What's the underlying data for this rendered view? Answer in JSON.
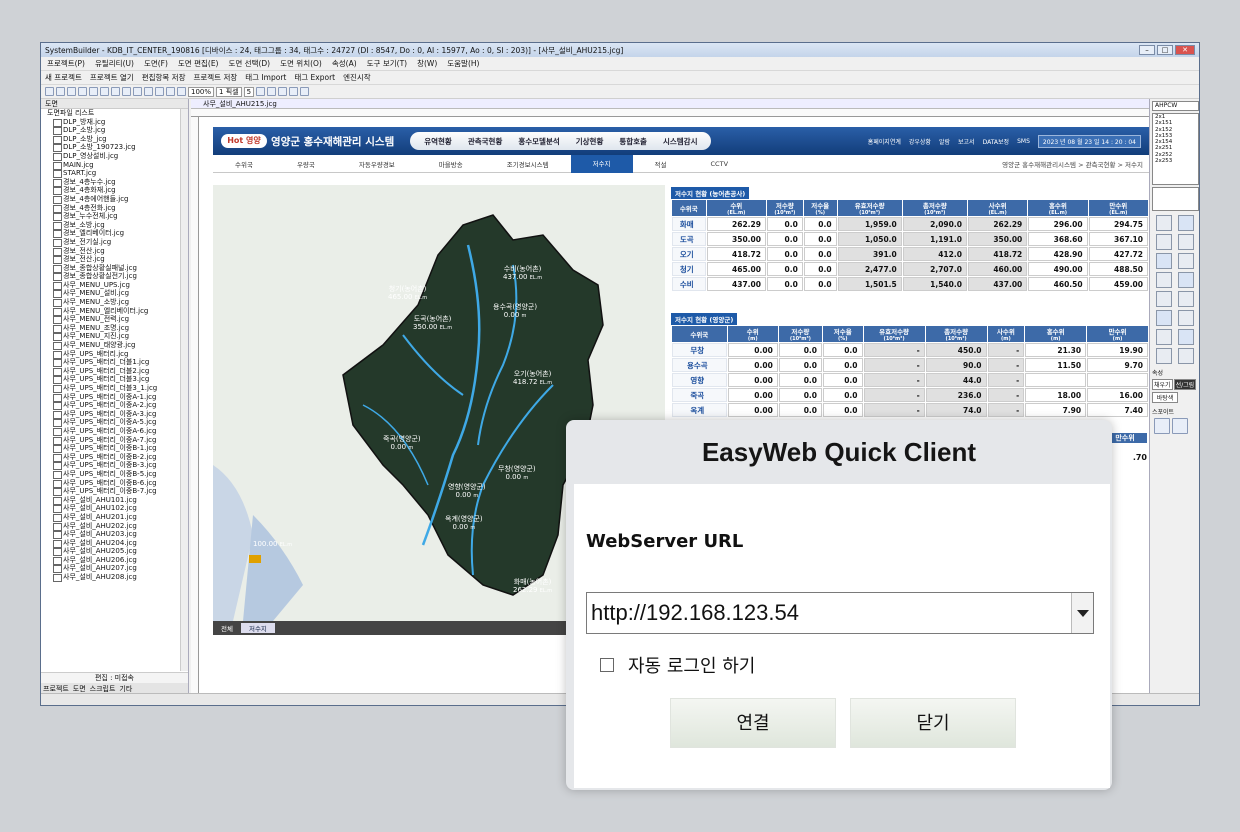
{
  "window": {
    "title": "SystemBuilder - KDB_IT_CENTER_190816 [디바이스 : 24, 태그그룹 : 34, 태그수 : 24727 (DI : 8547, Do : 0, AI : 15977, Ao : 0, SI : 203)] - [사무_설비_AHU215.jcg]"
  },
  "menubar": [
    "프로젝트(P)",
    "유틸리티(U)",
    "도면(F)",
    "도면 편집(E)",
    "도면 선택(D)",
    "도면 위치(O)",
    "속성(A)",
    "도구 보기(T)",
    "창(W)",
    "도움말(H)"
  ],
  "toolbar1": [
    "새 프로젝트",
    "프로젝트 열기",
    "편집항목 저장",
    "프로젝트 저장",
    "태그 Import",
    "태그 Export",
    "엔진시작"
  ],
  "toolbar2": {
    "zoom": "100%",
    "line": "1 픽셀",
    "size": "5"
  },
  "left_panel": {
    "title": "도면",
    "root": "도면파일 리스트",
    "items": [
      "DLP_방재.jcg",
      "DLP_소방.jcg",
      "DLP_소방_jcg",
      "DLP_소방_190723.jcg",
      "DLP_영상설비.jcg",
      "MAIN.jcg",
      "START.jcg",
      "경보_4층누수.jcg",
      "경보_4층화재.jcg",
      "경보_4층에어핸들.jcg",
      "경보_4층전화.jcg",
      "경보_누수전체.jcg",
      "경보_소방.jcg",
      "경보_엘리베이터.jcg",
      "경보_전기실.jcg",
      "경보_전산.jcg",
      "경보_전산.jcg",
      "경보_종합상황실패널.jcg",
      "경보_종합상황실전기.jcg",
      "사무_MENU_UPS.jcg",
      "사무_MENU_설비.jcg",
      "사무_MENU_소방.jcg",
      "사무_MENU_엘리베이터.jcg",
      "사무_MENU_전력.jcg",
      "사무_MENU_조명.jcg",
      "사무_MENU_지진.jcg",
      "사무_MENU_태양광.jcg",
      "사무_UPS_배터리.jcg",
      "사무_UPS_배터리_더블1.jcg",
      "사무_UPS_배터리_더블2.jcg",
      "사무_UPS_배터리_더블3.jcg",
      "사무_UPS_배터리_더블3_1.jcg",
      "사무_UPS_배터리_이중A-1.jcg",
      "사무_UPS_배터리_이중A-2.jcg",
      "사무_UPS_배터리_이중A-3.jcg",
      "사무_UPS_배터리_이중A-5.jcg",
      "사무_UPS_배터리_이중A-6.jcg",
      "사무_UPS_배터리_이중A-7.jcg",
      "사무_UPS_배터리_이중B-1.jcg",
      "사무_UPS_배터리_이중B-2.jcg",
      "사무_UPS_배터리_이중B-3.jcg",
      "사무_UPS_배터리_이중B-5.jcg",
      "사무_UPS_배터리_이중B-6.jcg",
      "사무_UPS_배터리_이중B-7.jcg",
      "사무_설비_AHU101.jcg",
      "사무_설비_AHU102.jcg",
      "사무_설비_AHU201.jcg",
      "사무_설비_AHU202.jcg",
      "사무_설비_AHU203.jcg",
      "사무_설비_AHU204.jcg",
      "사무_설비_AHU205.jcg",
      "사무_설비_AHU206.jcg",
      "사무_설비_AHU207.jcg",
      "사무_설비_AHU208.jcg"
    ],
    "status": "편집 : 미접속",
    "tabs": [
      "프로젝트",
      "도면",
      "스크립트",
      "기타"
    ]
  },
  "editor": {
    "tab": "사무_설비_AHU215.jcg"
  },
  "app": {
    "logo": "Hot 영양",
    "title": "영양군 홍수재해관리 시스템",
    "menu": [
      "유역현황",
      "관측국현황",
      "홍수모델분석",
      "기상현황",
      "통합호출",
      "시스템감시"
    ],
    "top_icons": [
      "홈페이지연계",
      "강우상황",
      "알람",
      "보고서",
      "DATA보정",
      "SMS"
    ],
    "date": "2023 년 08 월 23 일 14 : 20 : 04",
    "subnav": [
      "수위국",
      "우량국",
      "자동우량경보",
      "마을방송",
      "조기경보시스템",
      "저수지",
      "적설",
      "CCTV"
    ],
    "subnav_active": "저수지",
    "breadcrumb": "영양군 홍수재해관리시스템 > 관측국현황 > 저수지",
    "map_labels": [
      {
        "name": "청기(농어촌)",
        "value": "465.00",
        "unit": "EL.m"
      },
      {
        "name": "수비(농어촌)",
        "value": "437.00",
        "unit": "EL.m"
      },
      {
        "name": "용수곡(영양군)",
        "value": "0.00",
        "unit": "m"
      },
      {
        "name": "도곡(농어촌)",
        "value": "350.00",
        "unit": "EL.m"
      },
      {
        "name": "오기(농어촌)",
        "value": "418.72",
        "unit": "EL.m"
      },
      {
        "name": "죽곡(영양군)",
        "value": "0.00",
        "unit": "m"
      },
      {
        "name": "무창(영양군)",
        "value": "0.00",
        "unit": "m"
      },
      {
        "name": "영향(영양군)",
        "value": "0.00",
        "unit": "m"
      },
      {
        "name": "옥계(영양군)",
        "value": "0.00",
        "unit": "m"
      },
      {
        "name": "화매(농어촌)",
        "value": "262.29",
        "unit": "EL.m"
      },
      {
        "name": "",
        "value": "100.00",
        "unit": "EL.m"
      }
    ],
    "map_tabs": [
      "전체",
      "저수지"
    ],
    "table1": {
      "title": "저수지 현황 (농어촌공사)",
      "headers": [
        [
          "수위국",
          ""
        ],
        [
          "수위",
          "(EL.m)"
        ],
        [
          "저수량",
          "(10⁶m³)"
        ],
        [
          "저수율",
          "(%)"
        ],
        [
          "유효저수량",
          "(10⁶m³)"
        ],
        [
          "총저수량",
          "(10⁶m³)"
        ],
        [
          "사수위",
          "(EL.m)"
        ],
        [
          "홍수위",
          "(EL.m)"
        ],
        [
          "만수위",
          "(EL.m)"
        ]
      ],
      "rows": [
        [
          "화매",
          "262.29",
          "0.0",
          "0.0",
          "1,959.0",
          "2,090.0",
          "262.29",
          "296.00",
          "294.75"
        ],
        [
          "도곡",
          "350.00",
          "0.0",
          "0.0",
          "1,050.0",
          "1,191.0",
          "350.00",
          "368.60",
          "367.10"
        ],
        [
          "오기",
          "418.72",
          "0.0",
          "0.0",
          "391.0",
          "412.0",
          "418.72",
          "428.90",
          "427.72"
        ],
        [
          "청기",
          "465.00",
          "0.0",
          "0.0",
          "2,477.0",
          "2,707.0",
          "460.00",
          "490.00",
          "488.50"
        ],
        [
          "수비",
          "437.00",
          "0.0",
          "0.0",
          "1,501.5",
          "1,540.0",
          "437.00",
          "460.50",
          "459.00"
        ]
      ]
    },
    "table2": {
      "title": "저수지 현황 (영양군)",
      "headers": [
        [
          "수위국",
          ""
        ],
        [
          "수위",
          "(m)"
        ],
        [
          "저수량",
          "(10⁶m³)"
        ],
        [
          "저수율",
          "(%)"
        ],
        [
          "유효저수량",
          "(10⁶m³)"
        ],
        [
          "총저수량",
          "(10⁶m³)"
        ],
        [
          "사수위",
          "(m)"
        ],
        [
          "홍수위",
          "(m)"
        ],
        [
          "만수위",
          "(m)"
        ]
      ],
      "rows": [
        [
          "무창",
          "0.00",
          "0.0",
          "0.0",
          "-",
          "450.0",
          "-",
          "21.30",
          "19.90"
        ],
        [
          "용수곡",
          "0.00",
          "0.0",
          "0.0",
          "-",
          "90.0",
          "-",
          "11.50",
          "9.70"
        ],
        [
          "영향",
          "0.00",
          "0.0",
          "0.0",
          "-",
          "44.0",
          "-",
          "",
          ""
        ],
        [
          "죽곡",
          "0.00",
          "0.0",
          "0.0",
          "-",
          "236.0",
          "-",
          "18.00",
          "16.00"
        ],
        [
          "옥계",
          "0.00",
          "0.0",
          "0.0",
          "-",
          "74.0",
          "-",
          "7.90",
          "7.40"
        ]
      ]
    },
    "peek": {
      "header": "만수위",
      "value": ".70"
    }
  },
  "right_panel": {
    "combo": "AHPCW",
    "list": [
      "2x1",
      "2x151",
      "2x152",
      "2x153",
      "2x154",
      "2x251",
      "2x252",
      "2x253"
    ],
    "group1": "속성",
    "btn_a": "채우기",
    "btn_b": "선/그림",
    "btn_c": "바탕색",
    "group2": "스포이트"
  },
  "dialog": {
    "title": "EasyWeb Quick Client",
    "label": "WebServer URL",
    "url": "http://192.168.123.54",
    "checkbox": "자동 로그인 하기",
    "connect": "연결",
    "close": "닫기"
  }
}
